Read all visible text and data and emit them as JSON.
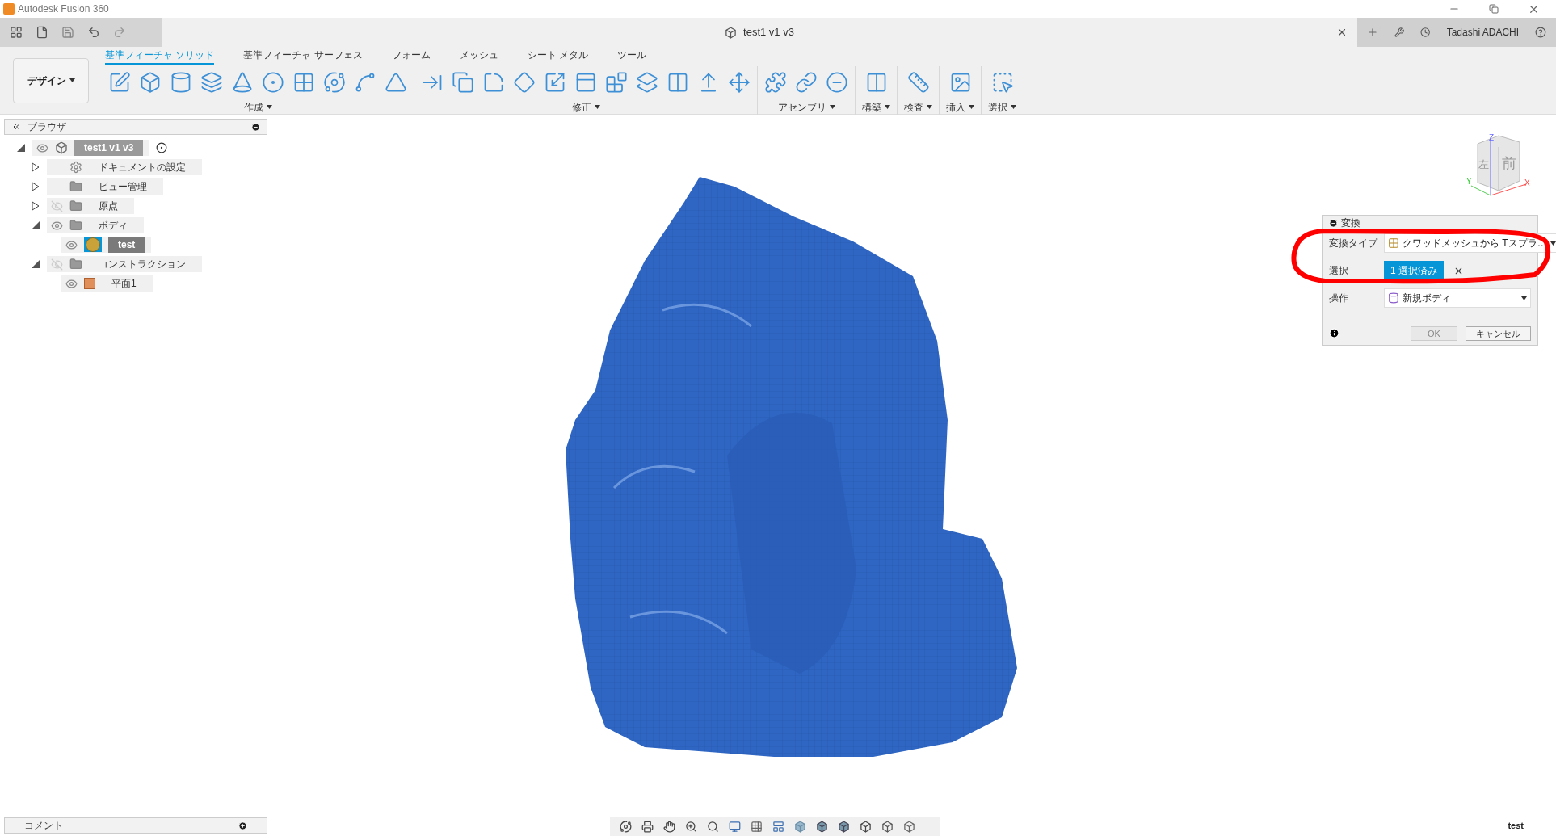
{
  "window": {
    "app_title": "Autodesk Fusion 360",
    "document_tab": "test1 v1 v3",
    "user": "Tadashi ADACHI"
  },
  "workspace": {
    "label": "デザイン"
  },
  "ribbon_tabs": [
    {
      "label": "基準フィーチャ ソリッド",
      "selected": true
    },
    {
      "label": "基準フィーチャ サーフェス",
      "selected": false
    },
    {
      "label": "フォーム",
      "selected": false
    },
    {
      "label": "メッシュ",
      "selected": false
    },
    {
      "label": "シート メタル",
      "selected": false
    },
    {
      "label": "ツール",
      "selected": false
    }
  ],
  "tool_groups": [
    {
      "label": "作成"
    },
    {
      "label": "修正"
    },
    {
      "label": "アセンブリ"
    },
    {
      "label": "構築"
    },
    {
      "label": "検査"
    },
    {
      "label": "挿入"
    },
    {
      "label": "選択"
    }
  ],
  "browser": {
    "title": "ブラウザ",
    "root": {
      "label": "test1 v1 v3",
      "kind": "component",
      "expanded": true,
      "visible": true,
      "selected": false,
      "children": [
        {
          "label": "ドキュメントの設定",
          "kind": "settings",
          "expanded": false,
          "selected": false
        },
        {
          "label": "ビュー管理",
          "kind": "folder",
          "expanded": false,
          "selected": false
        },
        {
          "label": "原点",
          "kind": "folder",
          "expanded": false,
          "visible": false,
          "selected": false
        },
        {
          "label": "ボディ",
          "kind": "folder",
          "expanded": true,
          "visible": true,
          "selected": false,
          "children": [
            {
              "label": "test",
              "kind": "body",
              "visible": true,
              "selected": true
            }
          ]
        },
        {
          "label": "コンストラクション",
          "kind": "folder",
          "expanded": true,
          "visible": false,
          "selected": false,
          "children": [
            {
              "label": "平面1",
              "kind": "plane",
              "visible": true,
              "selected": false
            }
          ]
        }
      ]
    }
  },
  "viewcube": {
    "faces": [
      "左",
      "前"
    ],
    "axes": [
      "Z",
      "Y",
      "X"
    ]
  },
  "dialog": {
    "title": "変換",
    "rows": [
      {
        "kind": "dropdown",
        "label": "変換タイプ",
        "value": "クワッドメッシュから Tスプラ…"
      },
      {
        "kind": "selection",
        "label": "選択",
        "value": "1 選択済み"
      },
      {
        "kind": "dropdown",
        "label": "操作",
        "value": "新規ボディ"
      }
    ],
    "buttons": [
      {
        "label": "OK",
        "disabled": true
      },
      {
        "label": "キャンセル",
        "disabled": false
      }
    ]
  },
  "comments": {
    "title": "コメント"
  },
  "status": "test"
}
